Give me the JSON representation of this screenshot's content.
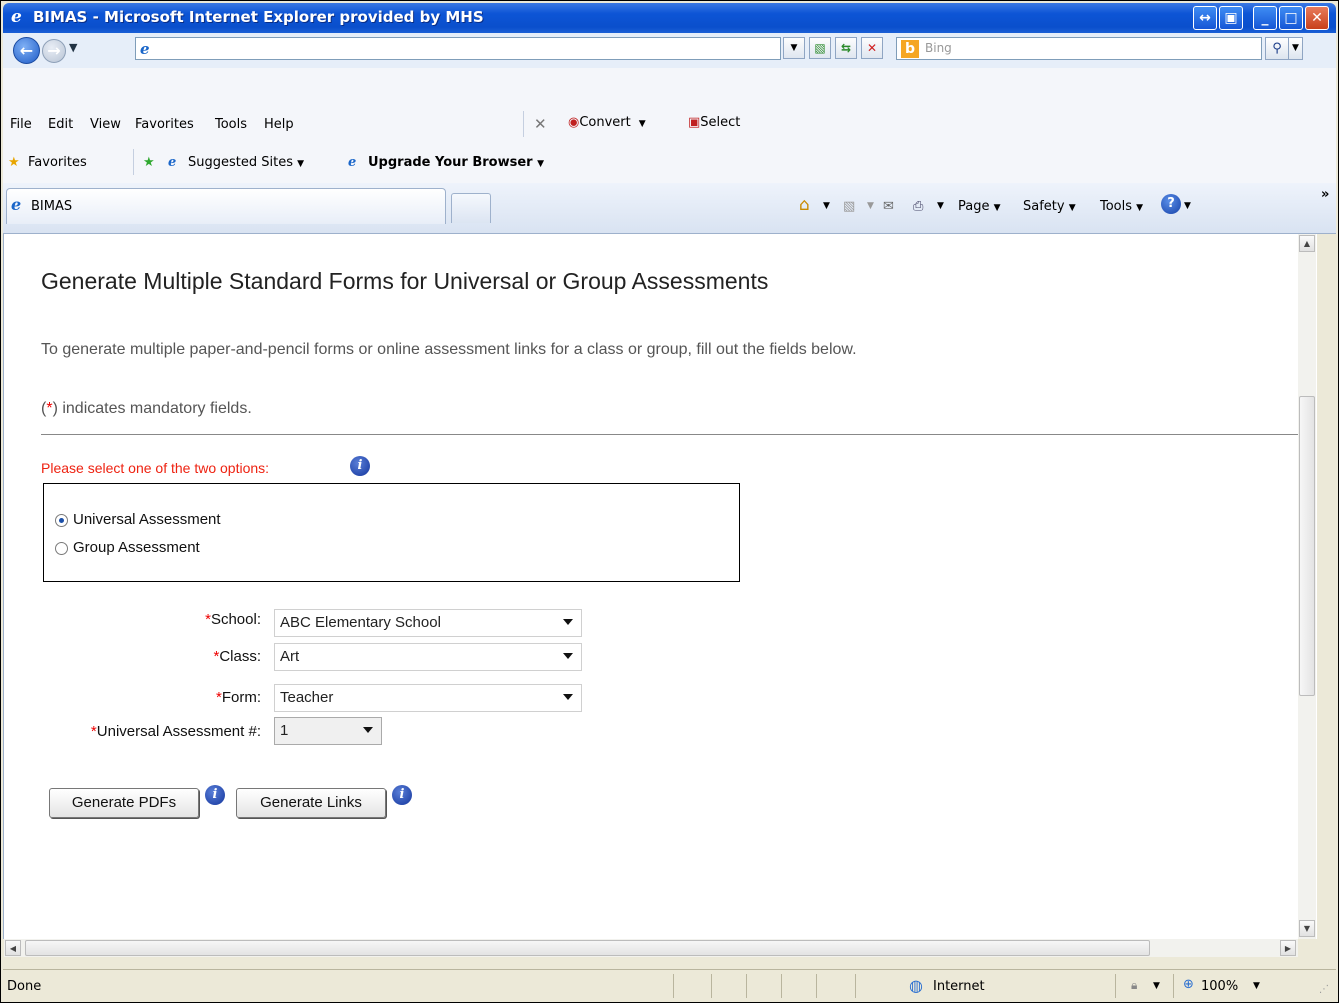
{
  "window": {
    "title": "BIMAS - Microsoft Internet Explorer provided by MHS"
  },
  "address_bar": {
    "url": "",
    "search_placeholder": "Bing"
  },
  "menu": {
    "items": [
      "File",
      "Edit",
      "View",
      "Favorites",
      "Tools",
      "Help"
    ],
    "convert_label": "Convert",
    "select_label": "Select"
  },
  "favorites_bar": {
    "favorites_label": "Favorites",
    "suggested_sites": "Suggested Sites",
    "upgrade": "Upgrade Your Browser"
  },
  "tabs": {
    "active": "BIMAS"
  },
  "command_bar": {
    "page": "Page",
    "safety": "Safety",
    "tools": "Tools"
  },
  "page": {
    "title": "Generate Multiple Standard Forms for Universal or Group Assessments",
    "intro": "To generate multiple paper-and-pencil forms or online assessment links for a class or group, fill out the fields below.",
    "mandatory_prefix": "(",
    "mandatory_star": "*",
    "mandatory_suffix": ") indicates mandatory fields.",
    "option_prompt": "Please select one of the two options:",
    "options": [
      {
        "label": "Universal Assessment",
        "selected": true
      },
      {
        "label": "Group Assessment",
        "selected": false
      }
    ],
    "fields": {
      "school": {
        "label": "School:",
        "value": "ABC Elementary School"
      },
      "class": {
        "label": "Class:",
        "value": "Art"
      },
      "form": {
        "label": "Form:",
        "value": "Teacher"
      },
      "universal_number": {
        "label": "Universal Assessment #:",
        "value": "1"
      }
    },
    "required_marker": "*",
    "buttons": {
      "generate_pdfs": "Generate PDFs",
      "generate_links": "Generate Links"
    }
  },
  "status_bar": {
    "status": "Done",
    "zone": "Internet",
    "zoom": "100%"
  },
  "colors": {
    "titlebar": "#0a4fcc",
    "required": "#e00000",
    "info_icon": "#13359c"
  }
}
